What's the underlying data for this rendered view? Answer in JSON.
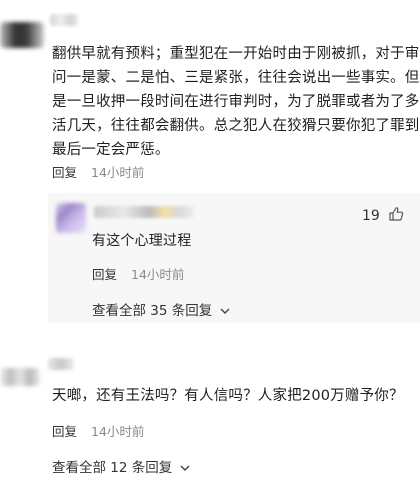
{
  "comments": [
    {
      "text_lines": [
        "翻供早就有预料；重型犯在一开始时由于刚被抓，对于审",
        "问一是蒙、二是怕、三是紧张，往往会说出一些事实。但",
        "是一旦收押一段时间在进行审判时，为了脱罪或者为了多",
        "活几天，往往都会翻供。总之犯人在狡猾只要你犯了罪到",
        "最后一定会严惩。"
      ],
      "reply_label": "回复",
      "time": "14小时前",
      "sub_reply": {
        "text": "有这个心理过程",
        "likes": "19",
        "reply_label": "回复",
        "time": "14小时前"
      },
      "view_all": "查看全部 35 条回复"
    },
    {
      "text": "天啷，还有王法吗？有人信吗？人家把200万赠予你？",
      "reply_label": "回复",
      "time": "14小时前",
      "view_all": "查看全部 12 条回复"
    }
  ],
  "icons": {
    "like": "thumbs-up-icon",
    "expand": "chevron-down-icon"
  }
}
